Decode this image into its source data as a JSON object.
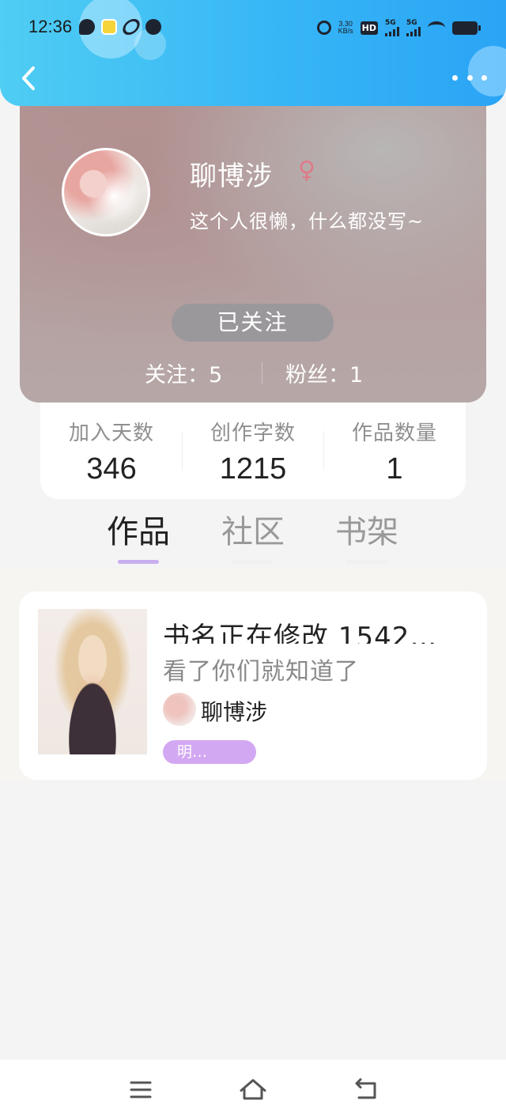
{
  "status_bar": {
    "time": "12:36",
    "network_speed_top": "3.30",
    "network_speed_unit": "KB/s",
    "hd_label": "HD",
    "signal1_label": "5G",
    "signal2_label": "5G",
    "icons": [
      "chat-icon",
      "app-icon",
      "link-icon",
      "bot-icon",
      "alarm-icon",
      "wifi-icon",
      "battery-icon"
    ]
  },
  "header": {
    "back_icon": "chevron-left-icon",
    "more_icon": "more-dots-icon"
  },
  "profile": {
    "name": "聊博涉",
    "gender_symbol": "♀",
    "bio": "这个人很懒，什么都没写~",
    "follow_button_label": "已关注",
    "following_label": "关注：5",
    "fans_label": "粉丝：1"
  },
  "stats": {
    "days_label": "加入天数",
    "days_value": "346",
    "words_label": "创作字数",
    "words_value": "1215",
    "works_label": "作品数量",
    "works_value": "1"
  },
  "tabs": [
    {
      "label": "作品",
      "active": true
    },
    {
      "label": "社区",
      "active": false
    },
    {
      "label": "书架",
      "active": false
    }
  ],
  "works": [
    {
      "title": "书名正在修改 1542…",
      "description": "看了你们就知道了",
      "author": "聊博涉",
      "tag": "明…"
    }
  ],
  "colors": {
    "header_accent": "#37b6f6",
    "tab_indicator_active": "#c9aef0",
    "tag_purple": "#d3a8f2",
    "gender_female": "#e07a88"
  }
}
